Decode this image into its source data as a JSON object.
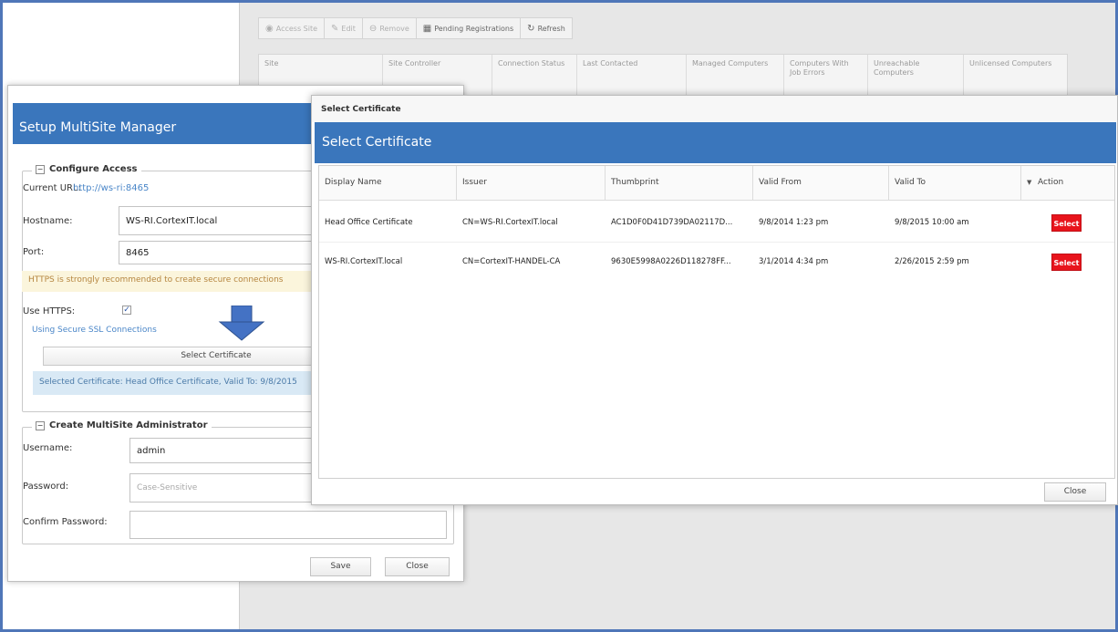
{
  "background": {
    "toolbar": [
      {
        "label": "Access Site",
        "icon": "globe-icon",
        "active": false
      },
      {
        "label": "Edit",
        "icon": "edit-icon",
        "active": false
      },
      {
        "label": "Remove",
        "icon": "remove-icon",
        "active": false
      },
      {
        "label": "Pending Registrations",
        "icon": "grid-icon",
        "active": true
      },
      {
        "label": "Refresh",
        "icon": "refresh-icon",
        "active": true
      }
    ],
    "columns": [
      "Site",
      "Site Controller",
      "Connection Status",
      "Last Contacted",
      "Managed Computers",
      "Computers With Job Errors",
      "Unreachable Computers",
      "Unlicensed Computers"
    ]
  },
  "setup": {
    "title": "Setup MultiSite Manager",
    "configure_access": {
      "legend": "Configure Access",
      "collapse": "−",
      "current_url_label": "Current URL:",
      "current_url": "http://ws-ri:8465",
      "hostname_label": "Hostname:",
      "hostname_value": "WS-RI.CortexIT.local",
      "port_label": "Port:",
      "port_value": "8465",
      "https_warning": "HTTPS is strongly recommended to create secure connections",
      "use_https_label": "Use HTTPS:",
      "use_https_checked": "✓",
      "ssl_link": "Using Secure SSL Connections",
      "select_certificate_button": "Select Certificate",
      "selected_certificate": "Selected Certificate: Head Office Certificate, Valid To: 9/8/2015"
    },
    "create_admin": {
      "legend": "Create MultiSite Administrator",
      "collapse": "−",
      "username_label": "Username:",
      "username_value": "admin",
      "password_label": "Password:",
      "password_placeholder": "Case-Sensitive",
      "confirm_label": "Confirm Password:"
    },
    "save_button": "Save",
    "close_button": "Close"
  },
  "cert_dialog": {
    "window_title": "Select Certificate",
    "header": "Select Certificate",
    "columns": [
      "Display Name",
      "Issuer",
      "Thumbprint",
      "Valid From",
      "Valid To",
      "Action"
    ],
    "sort_indicator": "▼",
    "rows": [
      {
        "display_name": "Head Office Certificate",
        "issuer": "CN=WS-RI.CortexIT.local",
        "thumbprint": "AC1D0F0D41D739DA02117D...",
        "valid_from": "9/8/2014 1:23 pm",
        "valid_to": "9/8/2015 10:00 am",
        "action": "Select"
      },
      {
        "display_name": "WS-RI.CortexIT.local",
        "issuer": "CN=CortexIT-HANDEL-CA",
        "thumbprint": "9630E5998A0226D118278FF...",
        "valid_from": "3/1/2014 4:34 pm",
        "valid_to": "2/26/2015 2:59 pm",
        "action": "Select"
      }
    ],
    "close_button": "Close"
  },
  "colors": {
    "frame": "#4f76b8",
    "header_blue": "#3a76bc",
    "select_red": "#e8141c",
    "arrow_blue": "#4472c4"
  }
}
